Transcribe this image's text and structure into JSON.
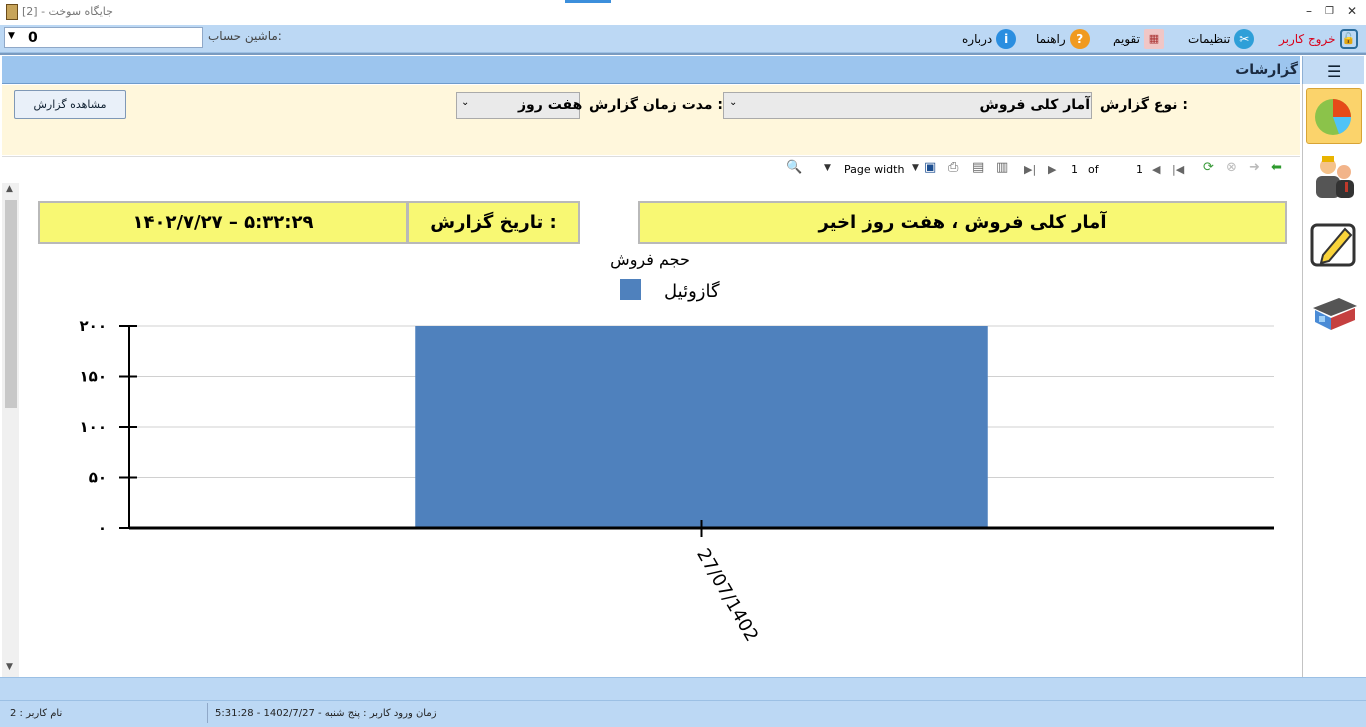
{
  "window": {
    "title": "[جایگاه سوخت - [2"
  },
  "toolbar": {
    "account_label": "ماشین حساب:",
    "account_value": "0",
    "logout": "خروج کاربر",
    "settings": "تنظیمات",
    "calendar": "تقویم",
    "help": "راهنما",
    "about": "درباره"
  },
  "reports_bar": {
    "title": "گزارشات"
  },
  "filters": {
    "report_type_label": "نوع گزارش :",
    "report_type_value": "آمار کلی فروش",
    "duration_label": "مدت زمان گزارش :",
    "duration_value": "هفت روز",
    "view_button": "مشاهده گزارش"
  },
  "viewer": {
    "zoom_mode": "Page width",
    "page_current": "1",
    "of_label": "of",
    "page_total": "1"
  },
  "report": {
    "title": "آمار کلی فروش ، هفت روز اخیر",
    "date_label": "تاریخ گزارش :",
    "date_value": "۱۴۰۲/۷/۲۷ – ۵:۳۲:۲۹"
  },
  "chart_data": {
    "type": "bar",
    "title": "حجم فروش",
    "categories": [
      "27/07/1402"
    ],
    "series": [
      {
        "name": "گازوئیل",
        "values": [
          200
        ],
        "color": "#4f81bd"
      }
    ],
    "ylim": [
      0,
      200
    ],
    "yticks": [
      "۰",
      "۵۰",
      "۱۰۰",
      "۱۵۰",
      "۲۰۰"
    ],
    "grid": true,
    "legend": "top"
  },
  "status": {
    "user": "نام کاربر : 2",
    "login": "زمان ورود کاربر : پنج شنبه - 1402/7/27 - 5:31:28"
  }
}
